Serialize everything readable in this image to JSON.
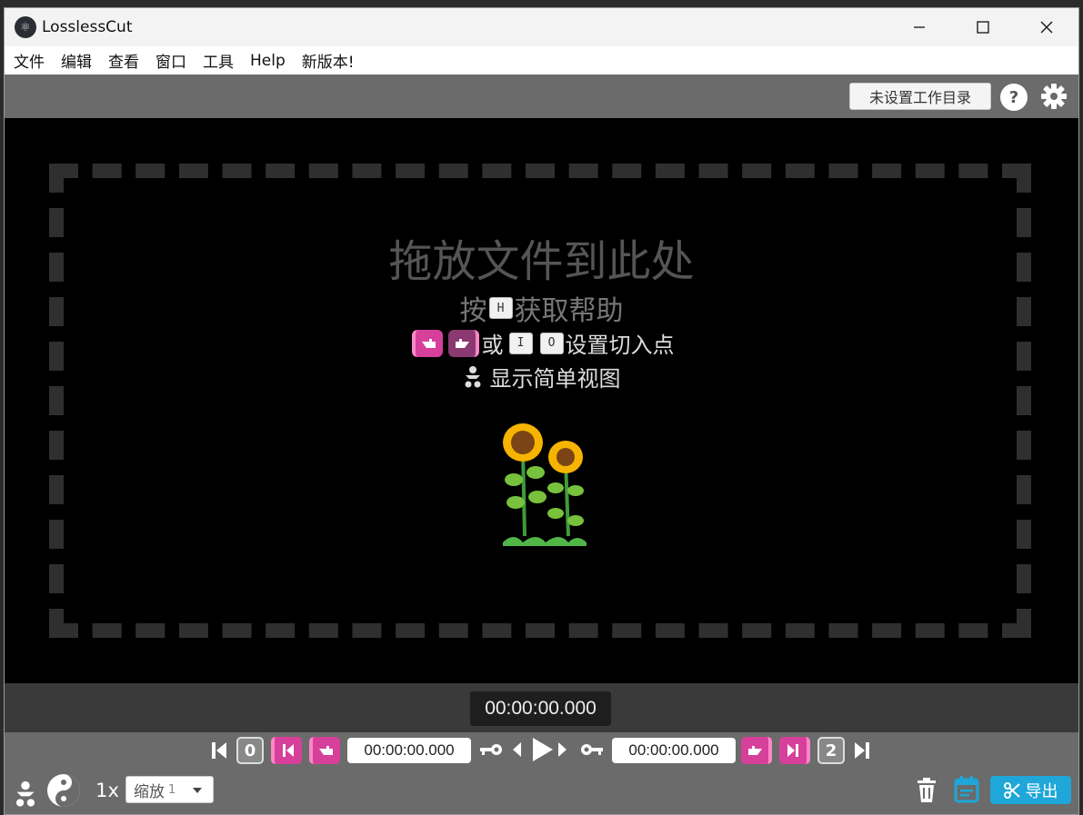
{
  "window": {
    "title": "LosslessCut"
  },
  "menu": {
    "items": [
      "文件",
      "编辑",
      "查看",
      "窗口",
      "工具",
      "Help",
      "新版本!"
    ]
  },
  "toolbar": {
    "workdir_label": "未设置工作目录",
    "help_label": "?"
  },
  "drop": {
    "title": "拖放文件到此处",
    "help_prefix": "按",
    "help_key": "H",
    "help_suffix": "获取帮助",
    "cut_or": "或",
    "cut_key_in": "I",
    "cut_key_out": "O",
    "cut_suffix": "设置切入点",
    "simple_view": "显示简单视图"
  },
  "timeline": {
    "current_time": "00:00:00.000"
  },
  "controls": {
    "start_segment": "0",
    "end_segment": "2",
    "cut_start_time": "00:00:00.000",
    "cut_end_time": "00:00:00.000",
    "speed": "1x",
    "zoom_label": "缩放",
    "zoom_value": "1",
    "export_label": "导出"
  },
  "colors": {
    "accent": "#1ea7d8",
    "cut_pink": "#d6409a",
    "stage": "#000000",
    "panel": "#6b6b6b"
  },
  "icons": [
    "app-icon",
    "minimize-icon",
    "maximize-icon",
    "close-icon",
    "help-icon",
    "gear-icon",
    "hand-left-icon",
    "hand-right-icon",
    "baby-icon",
    "sunflower-icon",
    "jump-start-icon",
    "jump-cut-start-icon",
    "set-cut-start-icon",
    "key-icon",
    "prev-frame-icon",
    "play-icon",
    "next-frame-icon",
    "set-cut-end-icon",
    "jump-cut-end-icon",
    "jump-end-icon",
    "yin-yang-icon",
    "trash-icon",
    "calendar-icon",
    "scissors-icon"
  ]
}
